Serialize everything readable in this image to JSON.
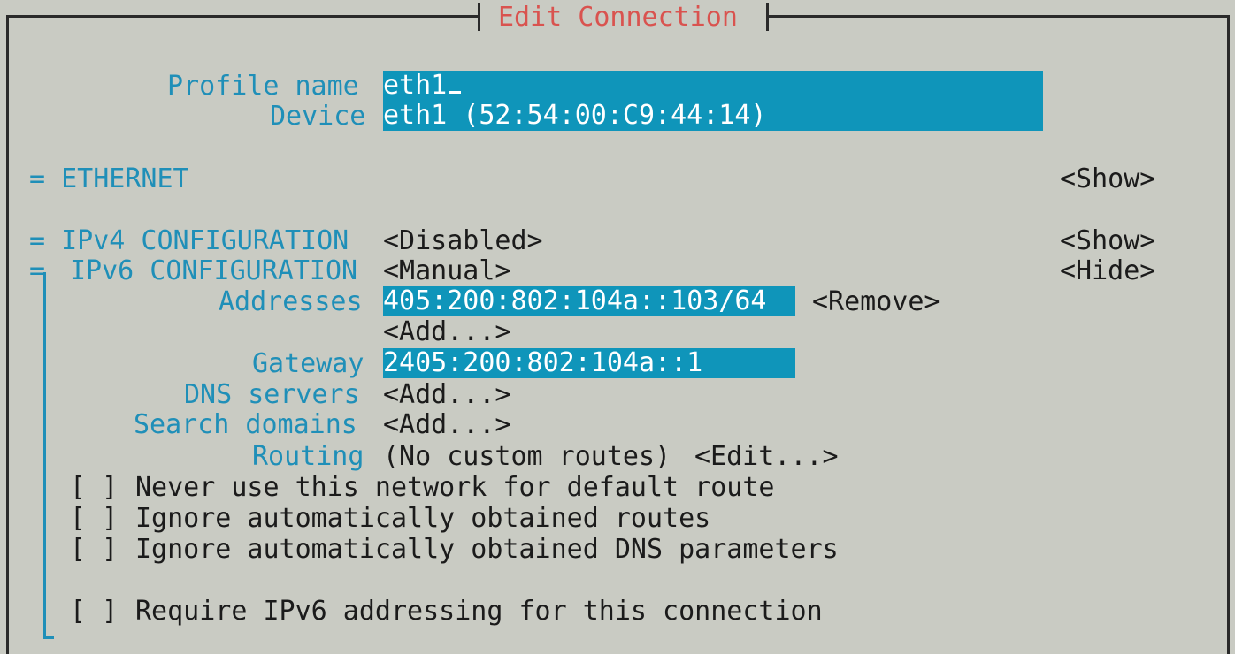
{
  "dialog": {
    "title": "Edit Connection"
  },
  "profile": {
    "label": "Profile name",
    "value": "eth1"
  },
  "device": {
    "label": "Device",
    "value": "eth1 (52:54:00:C9:44:14)"
  },
  "ethernet": {
    "header": "= ETHERNET",
    "toggle": "<Show>"
  },
  "ipv4": {
    "header": "= IPv4 CONFIGURATION",
    "mode": "<Disabled>",
    "toggle": "<Show>"
  },
  "ipv6": {
    "header": "IPv6 CONFIGURATION",
    "mode": "<Manual>",
    "toggle": "<Hide>",
    "addresses_label": "Addresses",
    "address_value": "405:200:802:104a::103/64",
    "remove": "<Remove>",
    "add": "<Add...>",
    "gateway_label": "Gateway",
    "gateway_value": "2405:200:802:104a::1",
    "dns_label": "DNS servers",
    "dns_add": "<Add...>",
    "search_label": "Search domains",
    "search_add": "<Add...>",
    "routing_label": "Routing",
    "routing_value": "(No custom routes)",
    "routing_edit": "<Edit...>",
    "checkbox_mark": "[ ]",
    "never_default": "Never use this network for default route",
    "ignore_routes": "Ignore automatically obtained routes",
    "ignore_dns": "Ignore automatically obtained DNS parameters",
    "require_ipv6": "Require IPv6 addressing for this connection"
  }
}
